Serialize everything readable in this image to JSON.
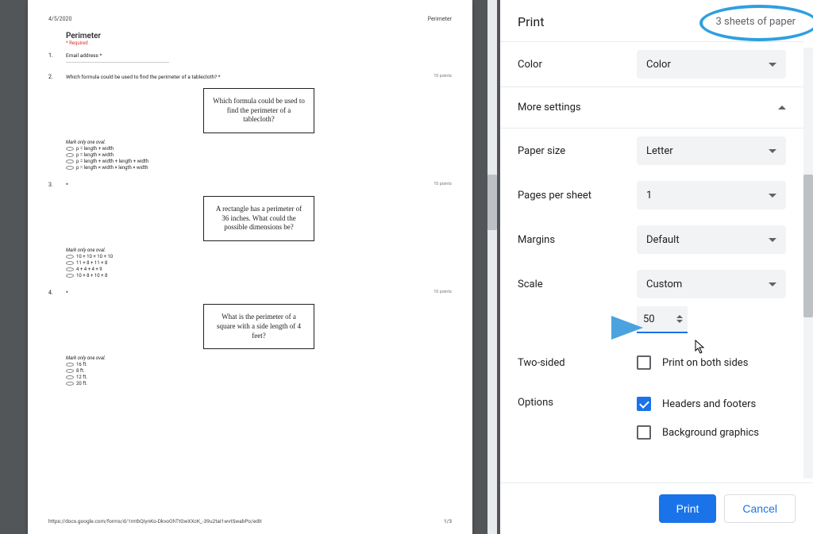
{
  "preview": {
    "date": "4/5/2020",
    "doc_title": "Perimeter",
    "form_title": "Perimeter",
    "required_note": "* Required",
    "q1": {
      "num": "1.",
      "text": "Email address *"
    },
    "q2": {
      "num": "2.",
      "text": "Which formula could be used to find the perimeter of a tablecloth? *",
      "points": "10 points",
      "card": "Which formula could be used to find the perimeter of a tablecloth?",
      "mark": "Mark only one oval.",
      "opts": [
        "p = length + width",
        "p = length × width",
        "p = length + width + length + width",
        "p = length × width × length × width"
      ]
    },
    "q3": {
      "num": "3.",
      "text": "*",
      "points": "10 points",
      "card": "A rectangle has a perimeter of 36 inches. What could the possible dimensions be?",
      "mark": "Mark only one oval.",
      "opts": [
        "10 + 10 + 10 + 10",
        "11 + 8 + 11 + 8",
        "4 + 4 + 4 + 9",
        "10 + 8 + 10 + 8"
      ]
    },
    "q4": {
      "num": "4.",
      "text": "*",
      "points": "10 points",
      "card": "What is the perimeter of a square with a side length of 4 feet?",
      "mark": "Mark only one oval.",
      "opts": [
        "16 ft.",
        "8 ft.",
        "12 ft.",
        "20 ft."
      ]
    },
    "footer_url": "https://docs.google.com/forms/d/1mtbQIynKo-DkvoOhTtGwXXcK_-39u2taI1wvtSwabPo/edit",
    "footer_page": "1/3"
  },
  "panel": {
    "title": "Print",
    "sheets": "3 sheets of paper",
    "color_label": "Color",
    "color_value": "Color",
    "more_settings": "More settings",
    "paper_size_label": "Paper size",
    "paper_size_value": "Letter",
    "pps_label": "Pages per sheet",
    "pps_value": "1",
    "margins_label": "Margins",
    "margins_value": "Default",
    "scale_label": "Scale",
    "scale_value": "Custom",
    "scale_custom": "50",
    "two_sided_label": "Two-sided",
    "two_sided_check": "Print on both sides",
    "options_label": "Options",
    "headers_check": "Headers and footers",
    "bg_check": "Background graphics",
    "print_btn": "Print",
    "cancel_btn": "Cancel"
  }
}
